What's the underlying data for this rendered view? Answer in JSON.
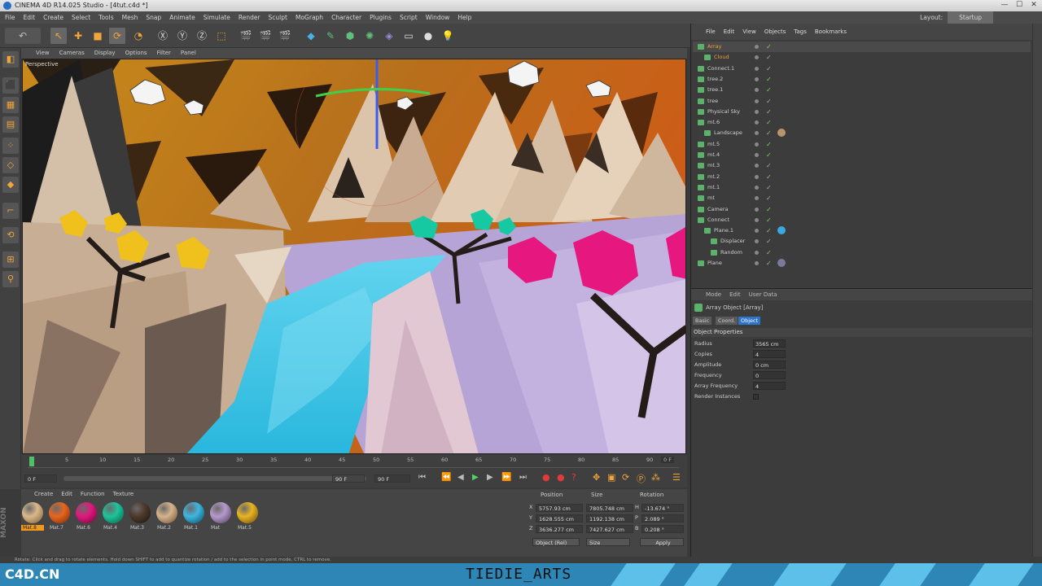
{
  "window": {
    "title": "CINEMA 4D R14.025 Studio - [4tut.c4d *]",
    "controls": [
      "—",
      "☐",
      "✕"
    ]
  },
  "menubar": [
    "File",
    "Edit",
    "Create",
    "Select",
    "Tools",
    "Mesh",
    "Snap",
    "Animate",
    "Simulate",
    "Render",
    "Sculpt",
    "MoGraph",
    "Character",
    "Plugins",
    "Script",
    "Window",
    "Help"
  ],
  "layout": {
    "label": "Layout:",
    "value": "Startup"
  },
  "viewport": {
    "menu": [
      "View",
      "Cameras",
      "Display",
      "Options",
      "Filter",
      "Panel"
    ],
    "label": "Perspective"
  },
  "timeline": {
    "ticks": [
      "0",
      "5",
      "10",
      "15",
      "20",
      "25",
      "30",
      "35",
      "40",
      "45",
      "50",
      "55",
      "60",
      "65",
      "70",
      "75",
      "80",
      "85",
      "90"
    ],
    "end_frame": "0 F",
    "start_field": "0 F",
    "end_field": "90 F",
    "range_end": "90 F"
  },
  "materials": {
    "menu": [
      "Create",
      "Edit",
      "Function",
      "Texture"
    ],
    "items": [
      {
        "label": "Mat.8",
        "color": "#d9b98a"
      },
      {
        "label": "Mat.7",
        "color": "#e8661e"
      },
      {
        "label": "Mat.6",
        "color": "#e0187e"
      },
      {
        "label": "Mat.4",
        "color": "#1dc49a"
      },
      {
        "label": "Mat.3",
        "color": "#4e3a2c"
      },
      {
        "label": "Mat.2",
        "color": "#d6b38c"
      },
      {
        "label": "Mat.1",
        "color": "#3fb6e0"
      },
      {
        "label": "Mat",
        "color": "#b59acb"
      },
      {
        "label": "Mat.5",
        "color": "#e8b422"
      }
    ]
  },
  "coordinates": {
    "headers": [
      "Position",
      "Size",
      "Rotation"
    ],
    "rows": [
      {
        "axis": "X",
        "pos": "5757.93 cm",
        "size": "7805.748 cm",
        "rlabel": "H",
        "rot": "-13.674 °"
      },
      {
        "axis": "Y",
        "pos": "1628.555 cm",
        "size": "1192.138 cm",
        "rlabel": "P",
        "rot": "2.089 °"
      },
      {
        "axis": "Z",
        "pos": "3636.277 cm",
        "size": "7427.627 cm",
        "rlabel": "B",
        "rot": "0.208 °"
      }
    ],
    "mode1": "Object (Rel)",
    "mode2": "Size",
    "apply": "Apply"
  },
  "objects": {
    "menu": [
      "File",
      "Edit",
      "View",
      "Objects",
      "Tags",
      "Bookmarks"
    ],
    "rows": [
      {
        "name": "Array",
        "color": "#f0a040",
        "ind": 0,
        "tag": ""
      },
      {
        "name": "Cloud",
        "color": "#f0a040",
        "ind": 1,
        "tag": ""
      },
      {
        "name": "Connect.1",
        "color": "#cfcfcf",
        "ind": 0,
        "tag": ""
      },
      {
        "name": "tree.2",
        "color": "#cfcfcf",
        "ind": 0,
        "tag": ""
      },
      {
        "name": "tree.1",
        "color": "#cfcfcf",
        "ind": 0,
        "tag": ""
      },
      {
        "name": "tree",
        "color": "#cfcfcf",
        "ind": 0,
        "tag": ""
      },
      {
        "name": "Physical Sky",
        "color": "#cfcfcf",
        "ind": 0,
        "tag": ""
      },
      {
        "name": "mt.6",
        "color": "#cfcfcf",
        "ind": 0,
        "tag": ""
      },
      {
        "name": "Landscape",
        "color": "#cfcfcf",
        "ind": 1,
        "tag": "#b8956a"
      },
      {
        "name": "mt.5",
        "color": "#cfcfcf",
        "ind": 0,
        "tag": ""
      },
      {
        "name": "mt.4",
        "color": "#cfcfcf",
        "ind": 0,
        "tag": ""
      },
      {
        "name": "mt.3",
        "color": "#cfcfcf",
        "ind": 0,
        "tag": ""
      },
      {
        "name": "mt.2",
        "color": "#cfcfcf",
        "ind": 0,
        "tag": ""
      },
      {
        "name": "mt.1",
        "color": "#cfcfcf",
        "ind": 0,
        "tag": ""
      },
      {
        "name": "mt",
        "color": "#cfcfcf",
        "ind": 0,
        "tag": ""
      },
      {
        "name": "Camera",
        "color": "#cfcfcf",
        "ind": 0,
        "tag": ""
      },
      {
        "name": "Connect",
        "color": "#cfcfcf",
        "ind": 0,
        "tag": ""
      },
      {
        "name": "Plane.1",
        "color": "#cfcfcf",
        "ind": 1,
        "tag": "#3aa8e0"
      },
      {
        "name": "Displacer",
        "color": "#cfcfcf",
        "ind": 2,
        "tag": ""
      },
      {
        "name": "Random",
        "color": "#cfcfcf",
        "ind": 2,
        "tag": ""
      },
      {
        "name": "Plane",
        "color": "#cfcfcf",
        "ind": 0,
        "tag": "#7a7a9a"
      }
    ]
  },
  "attributes": {
    "menu": [
      "Mode",
      "Edit",
      "User Data"
    ],
    "title": "Array Object [Array]",
    "tabs": [
      "Basic",
      "Coord.",
      "Object"
    ],
    "section": "Object Properties",
    "props": [
      {
        "label": "Radius",
        "value": "3565 cm"
      },
      {
        "label": "Copies",
        "value": "4"
      },
      {
        "label": "Amplitude",
        "value": "0 cm"
      },
      {
        "label": "Frequency",
        "value": "0"
      },
      {
        "label": "Array Frequency",
        "value": "4"
      },
      {
        "label": "Render Instances",
        "value": ""
      }
    ]
  },
  "status": "Rotate: Click and drag to rotate elements. Hold down SHIFT to add to quantize rotation / add to the selection in point mode, CTRL to remove.",
  "footer": {
    "left": "C4D.CN",
    "center": "TIEDIE_ARTS"
  }
}
